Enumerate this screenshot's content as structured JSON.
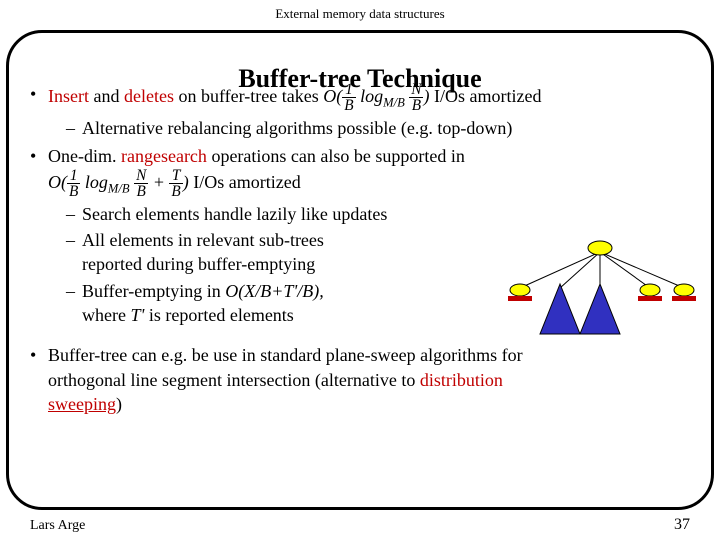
{
  "header": "External memory data structures",
  "title": "Buffer-tree Technique",
  "bullets": {
    "b1": {
      "pre": "Insert",
      "mid1": " and ",
      "del": "deletes",
      "mid2": " on buffer-tree takes ",
      "post": " I/Os amortized"
    },
    "b1s1": "Alternative rebalancing algorithms possible (e.g. top-down)",
    "b2": {
      "pre": "One-dim. ",
      "rs": "rangesearch",
      "post": " operations can also be supported in"
    },
    "b2_line2_post": "I/Os amortized",
    "b2s1": "Search elements handle lazily like updates",
    "b2s2a": "All elements in relevant sub-trees",
    "b2s2b": "reported during buffer-emptying",
    "b2s3a_pre": "Buffer-emptying in ",
    "b2s3a_formula": "O(X/B+T'/B),",
    "b2s3b_pre": "where ",
    "b2s3b_var": "T'",
    "b2s3b_post": " is reported elements",
    "b3a": "Buffer-tree can e.g. be use in standard plane-sweep algorithms for",
    "b3b_pre": "orthogonal line segment intersection (alternative to ",
    "b3b_red1": "distribution",
    "b3b_red2": "sweeping",
    "b3b_post": ")"
  },
  "formula1": {
    "O": "O(",
    "num1": "1",
    "den1": "B",
    "log": " log",
    "sub": "M/B",
    "num2": "N",
    "den2": "B",
    "close": ")"
  },
  "formula2": {
    "O": "O(",
    "num1": "1",
    "den1": "B",
    "log": " log",
    "sub": "M/B",
    "num2": "N",
    "den2": "B",
    "plus": " + ",
    "num3": "T",
    "den3": "B",
    "close": ")"
  },
  "footer": {
    "left": "Lars Arge",
    "right": "37"
  },
  "colors": {
    "red": "#c00000",
    "yellow": "#ffff00",
    "blue": "#3030c0"
  }
}
